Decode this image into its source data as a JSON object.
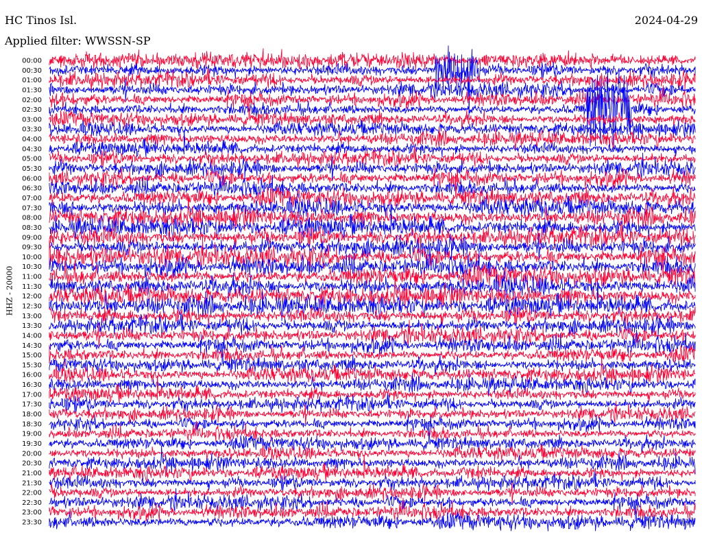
{
  "header": {
    "station": "HC Tinos Isl.",
    "date": "2024-04-29",
    "filter": "Applied filter: WWSSN-SP"
  },
  "chart_data": {
    "type": "line",
    "title": "HC Tinos Isl.",
    "subtitle": "Applied filter: WWSSN-SP",
    "date": "2024-04-29",
    "ylabel": "HHZ - 20000",
    "row_labels": [
      "00:00",
      "00:30",
      "01:00",
      "01:30",
      "02:00",
      "02:30",
      "03:00",
      "03:30",
      "04:00",
      "04:30",
      "05:00",
      "05:30",
      "06:00",
      "06:30",
      "07:00",
      "07:30",
      "08:00",
      "08:30",
      "09:00",
      "09:30",
      "10:00",
      "10:30",
      "11:00",
      "11:30",
      "12:00",
      "12:30",
      "13:00",
      "13:30",
      "14:00",
      "14:30",
      "15:00",
      "15:30",
      "16:00",
      "16:30",
      "17:00",
      "17:30",
      "18:00",
      "18:30",
      "19:00",
      "19:30",
      "20:00",
      "20:30",
      "21:00",
      "21:30",
      "22:00",
      "22:30",
      "23:00",
      "23:30"
    ],
    "trace_colors": [
      "#ff0033",
      "#0000ff"
    ],
    "row_activity": [
      0.55,
      0.55,
      0.6,
      0.6,
      0.55,
      0.5,
      0.45,
      0.45,
      0.5,
      0.5,
      0.6,
      0.7,
      0.75,
      0.7,
      0.75,
      0.85,
      0.9,
      0.95,
      1.0,
      1.0,
      1.0,
      1.0,
      1.0,
      1.0,
      0.95,
      0.9,
      0.85,
      0.75,
      0.7,
      0.65,
      0.6,
      0.55,
      0.55,
      0.5,
      0.5,
      0.5,
      0.45,
      0.45,
      0.4,
      0.4,
      0.4,
      0.45,
      0.45,
      0.5,
      0.5,
      0.55,
      0.55,
      0.6
    ],
    "events": [
      {
        "start": "00:30",
        "minute": 18,
        "duration_min": 2,
        "amplitude": 6.0
      },
      {
        "start": "02:30",
        "minute": 25,
        "duration_min": 2,
        "amplitude": 6.5
      },
      {
        "start": "21:00",
        "minute": 19,
        "duration_min": 1.5,
        "amplitude": 1.6
      }
    ],
    "grid": false
  }
}
